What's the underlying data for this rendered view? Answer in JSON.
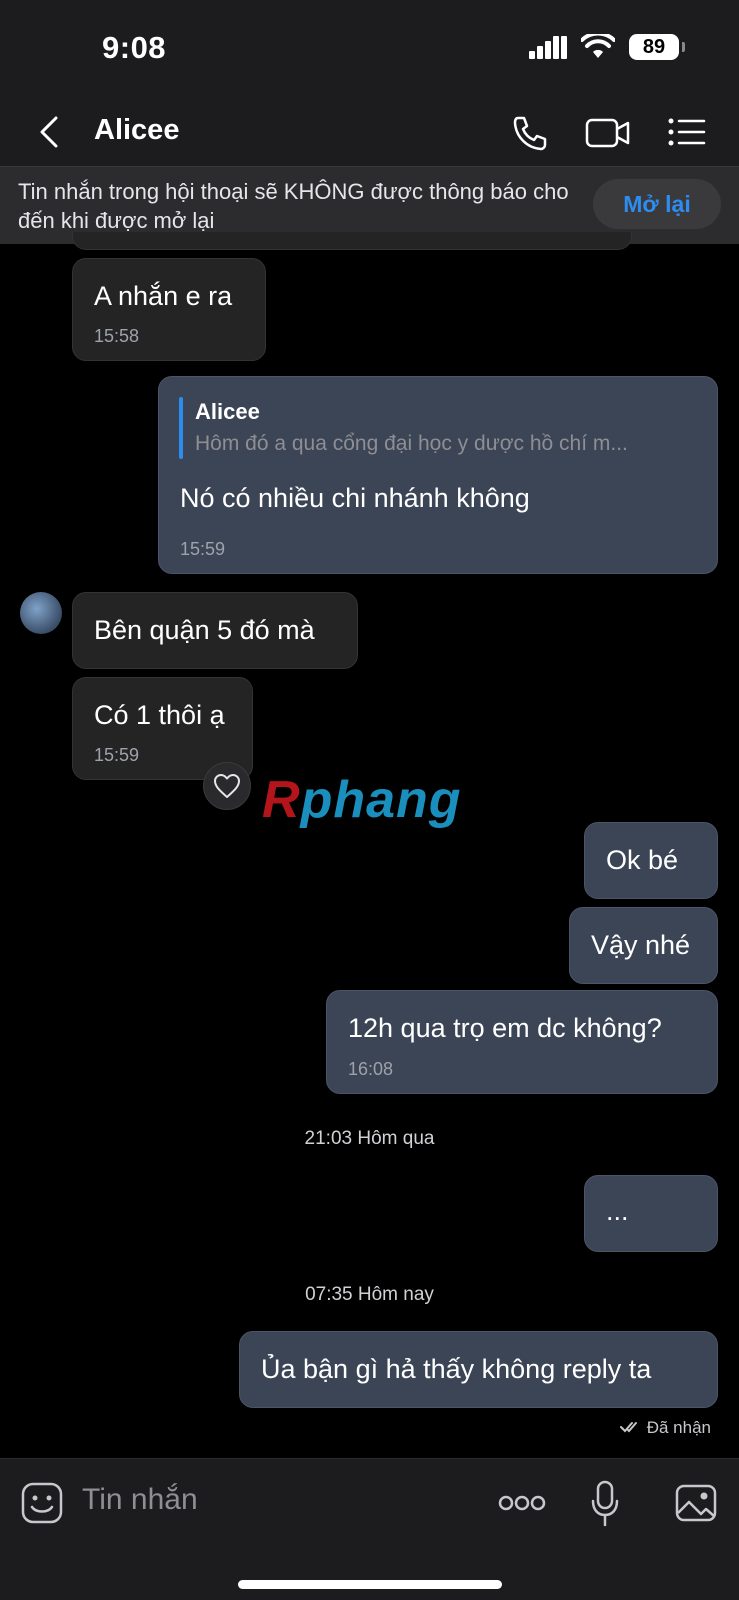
{
  "status_bar": {
    "time": "9:08",
    "battery": "89"
  },
  "header": {
    "contact_name": "Alicee"
  },
  "banner": {
    "text": "Tin nhắn trong hội thoại sẽ KHÔNG được thông báo cho đến khi được mở lại",
    "button": "Mở lại"
  },
  "messages": [
    {
      "dir": "in",
      "text": "A nhắn e ra",
      "time": "15:58"
    },
    {
      "dir": "out",
      "reply_to_name": "Alicee",
      "reply_to_text": "Hôm đó a qua cổng đại học y dược hồ chí m...",
      "text": "Nó có nhiều chi nhánh không",
      "time": "15:59"
    },
    {
      "dir": "in",
      "text": "Bên quận 5 đó mà"
    },
    {
      "dir": "in",
      "text": "Có 1 thôi ạ",
      "time": "15:59"
    },
    {
      "dir": "out",
      "text": "Ok bé"
    },
    {
      "dir": "out",
      "text": "Vậy nhé"
    },
    {
      "dir": "out",
      "text": "12h qua trọ em dc không?",
      "time": "16:08"
    },
    {
      "dir": "out",
      "text": "..."
    },
    {
      "dir": "out",
      "text": "Ủa bận gì hả thấy không reply ta"
    }
  ],
  "date_separators": [
    "21:03 Hôm qua",
    "07:35 Hôm nay"
  ],
  "receipt": "Đã nhận",
  "watermark": {
    "part1": "R",
    "part2": "phang"
  },
  "input": {
    "placeholder": "Tin nhắn"
  }
}
